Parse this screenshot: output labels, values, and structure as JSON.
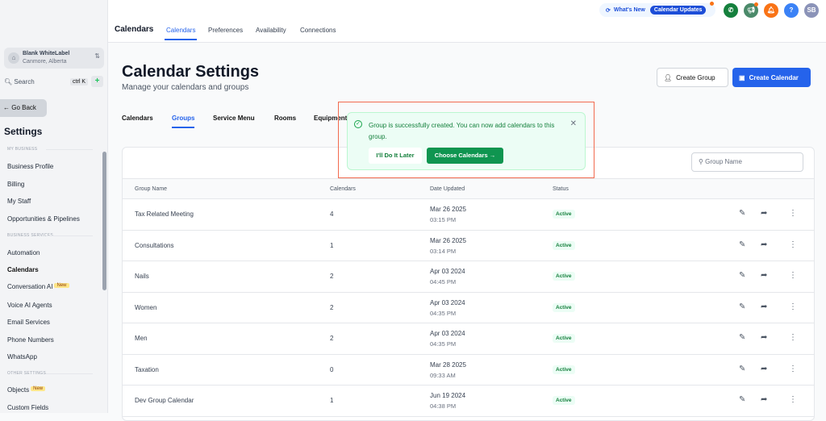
{
  "account": {
    "name": "Blank WhiteLabel",
    "location": "Canmore, Alberta"
  },
  "search": {
    "label": "Search",
    "shortcut": "ctrl K"
  },
  "go_back": "← Go Back",
  "settings_title": "Settings",
  "sections": {
    "my_business": "MY BUSINESS",
    "business_services": "BUSINESS SERVICES",
    "other_settings": "OTHER SETTINGS"
  },
  "sidebar": {
    "items": [
      "Business Profile",
      "Billing",
      "My Staff",
      "Opportunities & Pipelines",
      "Automation",
      "Calendars",
      "Conversation AI",
      "Voice AI Agents",
      "Email Services",
      "Phone Numbers",
      "WhatsApp",
      "Objects",
      "Custom Fields"
    ],
    "new_badge": "New"
  },
  "topbar": {
    "title": "Calendars",
    "tabs": [
      "Calendars",
      "Preferences",
      "Availability",
      "Connections"
    ],
    "whats_new": "What's New",
    "calendar_updates": "Calendar Updates",
    "avatar": "SB",
    "help": "?"
  },
  "page": {
    "title": "Calendar Settings",
    "subtitle": "Manage your calendars and groups",
    "create_group": "Create Group",
    "create_calendar": "Create Calendar"
  },
  "tabs": [
    "Calendars",
    "Groups",
    "Service Menu",
    "Rooms",
    "Equipment"
  ],
  "table": {
    "search_placeholder": "Group Name",
    "headers": [
      "Group Name",
      "Calendars",
      "Date Updated",
      "Status"
    ],
    "rows": [
      {
        "name": "Tax Related Meeting",
        "calendars": "4",
        "date": "Mar 26 2025",
        "time": "03:15 PM",
        "status": "Active"
      },
      {
        "name": "Consultations",
        "calendars": "1",
        "date": "Mar 26 2025",
        "time": "03:14 PM",
        "status": "Active"
      },
      {
        "name": "Nails",
        "calendars": "2",
        "date": "Apr 03 2024",
        "time": "04:45 PM",
        "status": "Active"
      },
      {
        "name": "Women",
        "calendars": "2",
        "date": "Apr 03 2024",
        "time": "04:35 PM",
        "status": "Active"
      },
      {
        "name": "Men",
        "calendars": "2",
        "date": "Apr 03 2024",
        "time": "04:35 PM",
        "status": "Active"
      },
      {
        "name": "Taxation",
        "calendars": "0",
        "date": "Mar 28 2025",
        "time": "09:33 AM",
        "status": "Active"
      },
      {
        "name": "Dev Group Calendar",
        "calendars": "1",
        "date": "Jun 19 2024",
        "time": "04:38 PM",
        "status": "Active"
      }
    ]
  },
  "toast": {
    "message": "Group is successfully created. You can now add calendars to this group.",
    "later": "I'll Do It Later",
    "choose": "Choose Calendars →"
  }
}
